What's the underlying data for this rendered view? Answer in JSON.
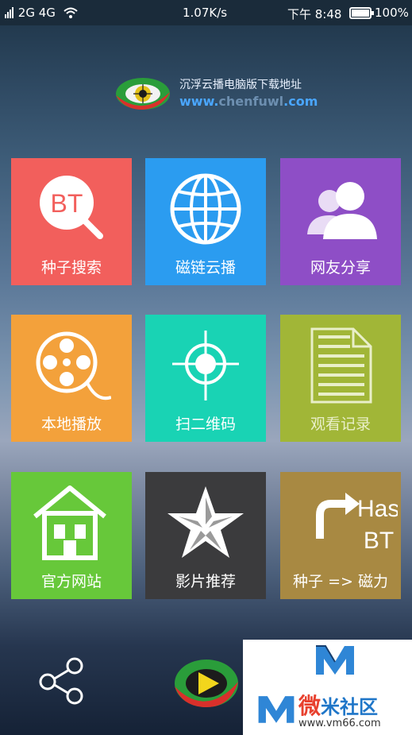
{
  "status_bar": {
    "left": "2G  4G",
    "net_speed": "1.07K/s",
    "time": "下午 8:48",
    "battery": "100%"
  },
  "banner": {
    "title": "沉浮云播电脑版下载地址",
    "url_prefix": "www.",
    "url_middle": "chenfuwl",
    "url_suffix": ".com"
  },
  "tiles": [
    {
      "label": "种子搜索",
      "color": "#f25f5c",
      "icon": "bt-search-icon"
    },
    {
      "label": "磁链云播",
      "color": "#2b9cf0",
      "icon": "globe-icon"
    },
    {
      "label": "网友分享",
      "color": "#8e4ec6",
      "icon": "users-icon"
    },
    {
      "label": "本地播放",
      "color": "#f3a13b",
      "icon": "film-reel-icon"
    },
    {
      "label": "扫二维码",
      "color": "#19d3b4",
      "icon": "crosshair-icon"
    },
    {
      "label": "观看记录",
      "color": "#a1b637",
      "icon": "document-icon"
    },
    {
      "label": "官方网站",
      "color": "#67c83a",
      "icon": "house-icon"
    },
    {
      "label": "影片推荐",
      "color": "#3b3b3d",
      "icon": "star-icon"
    },
    {
      "label": "种子 => 磁力",
      "color": "#a88942",
      "icon": "hash-bt-convert-icon",
      "hash_text": "Hash",
      "bt_text": "BT"
    }
  ],
  "bt_icon_text": "BT",
  "watermark": {
    "brand_first": "微",
    "brand_rest": "米社区",
    "url": "www.vm66.com"
  }
}
